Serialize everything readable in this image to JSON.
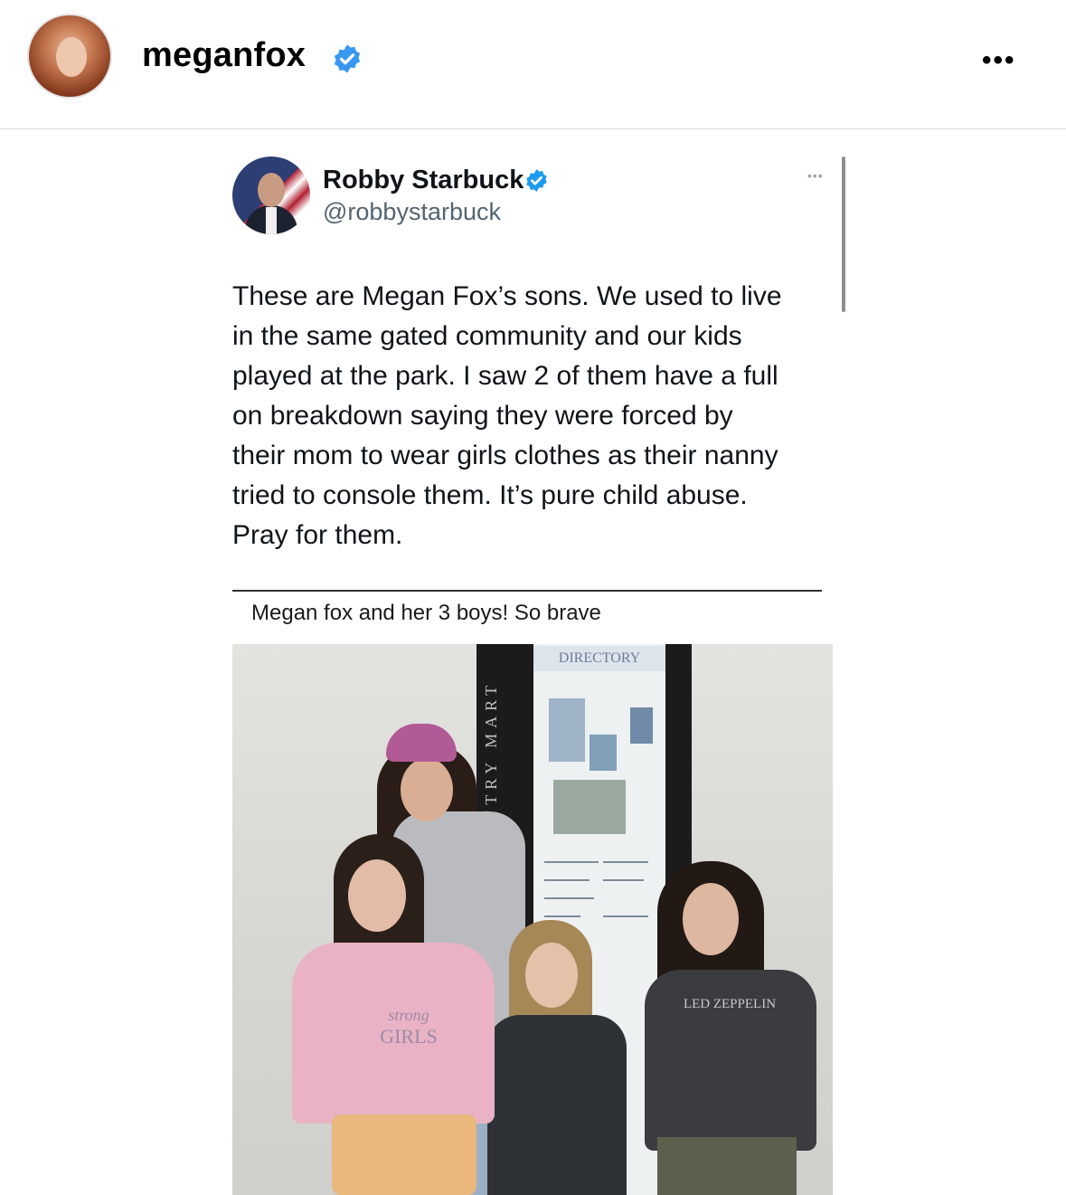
{
  "instagram": {
    "username": "meganfox",
    "verified_icon": "verified-badge-icon",
    "more_icon": "more-dots-icon",
    "more_label": "•••",
    "accent_color": "#3897f0"
  },
  "tweet": {
    "name": "Robby Starbuck",
    "handle": "@robbystarbuck",
    "more_label": "•••",
    "text": "These are Megan Fox’s sons. We used to live\nin the same gated community and our kids\nplayed at the park. I saw 2 of them have a full\non breakdown saying they were forced by\ntheir mom to wear girls clothes as their nanny\ntried to console them. It’s pure child abuse.\nPray for them.",
    "verified_color": "#1d9bf0"
  },
  "quoted": {
    "caption": "Megan fox and her 3 boys! So brave"
  },
  "photo": {
    "sign_directory": "DIRECTORY",
    "sign_vertical": "NTRY MART",
    "shirt_text_1": "strong",
    "shirt_text_2": "GIRLS",
    "shirt_text_3": "LED ZEPPELIN"
  }
}
